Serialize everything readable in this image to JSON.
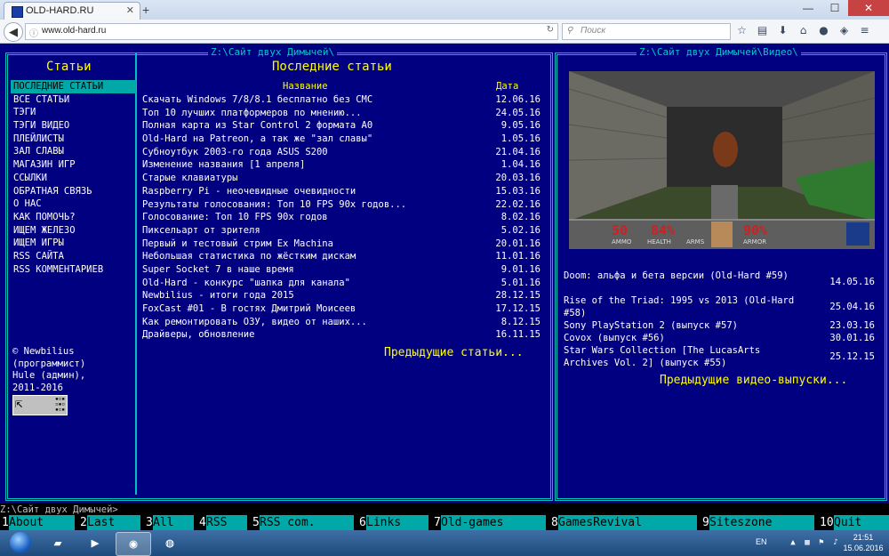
{
  "browser": {
    "tab_title": "OLD-HARD.RU",
    "tab_close": "✕",
    "new_tab": "+",
    "url": "www.old-hard.ru",
    "search_placeholder": "Поиск",
    "window_controls": [
      "—",
      "☐",
      "✕"
    ],
    "nav_icons": [
      "star-icon",
      "bookmarks-icon",
      "download-icon",
      "home-icon",
      "chat-icon",
      "pocket-icon",
      "menu-icon"
    ]
  },
  "left_panel": {
    "title": "Z:\\Сайт двух Димычей\\",
    "sidebar_heading": "Статьи",
    "nav": [
      "ПОСЛЕДНИЕ СТАТЬИ",
      "ВСЕ СТАТЬИ",
      "ТЭГИ",
      "ТЭГИ ВИДЕО",
      "ПЛЕЙЛИСТЫ",
      "ЗАЛ СЛАВЫ",
      "МАГАЗИН ИГР",
      "ССЫЛКИ",
      "ОБРАТНАЯ СВЯЗЬ",
      "О НАС",
      "КАК ПОМОЧЬ?",
      "ИЩЕМ ЖЕЛЕЗО",
      "ИЩЕМ ИГРЫ",
      "RSS САЙТА",
      "RSS КОММЕНТАРИЕВ"
    ],
    "credits": "© Newbilius\n(программист)\nHule (админ),\n2011-2016",
    "main_heading": "Последние статьи",
    "col_name": "Название",
    "col_date": "Дата",
    "articles": [
      {
        "title": "Скачать Windows 7/8/8.1 бесплатно без СМС",
        "date": "12.06.16"
      },
      {
        "title": "Топ 10 лучших платформеров по мнению...",
        "date": "24.05.16"
      },
      {
        "title": "Полная карта из Star Control 2 формата A0",
        "date": "9.05.16"
      },
      {
        "title": "Old-Hard на Patreon, а так же \"зал славы\"",
        "date": "1.05.16"
      },
      {
        "title": "Субноутбук 2003-го года ASUS S200",
        "date": "21.04.16"
      },
      {
        "title": "Изменение названия [1 апреля]",
        "date": "1.04.16"
      },
      {
        "title": "Старые клавиатуры",
        "date": "20.03.16"
      },
      {
        "title": "Raspberry Pi - неочевидные очевидности",
        "date": "15.03.16"
      },
      {
        "title": "Результаты голосования: Топ 10 FPS 90х годов...",
        "date": "22.02.16"
      },
      {
        "title": "Голосование: Топ 10 FPS 90х годов",
        "date": "8.02.16"
      },
      {
        "title": "Пиксельарт от зрителя",
        "date": "5.02.16"
      },
      {
        "title": "Первый и тестовый стрим Ex Machina",
        "date": "20.01.16"
      },
      {
        "title": "Небольшая статистика по жёстким дискам",
        "date": "11.01.16"
      },
      {
        "title": "Super Socket 7 в наше время",
        "date": "9.01.16"
      },
      {
        "title": "Old-Hard - конкурс \"шапка для канала\"",
        "date": "5.01.16"
      },
      {
        "title": "Newbilius - итоги года 2015",
        "date": "28.12.15"
      },
      {
        "title": "FoxCast #01 - В гостях Дмитрий Моисеев",
        "date": "17.12.15"
      },
      {
        "title": "Как ремонтировать ОЗУ, видео от наших...",
        "date": "8.12.15"
      },
      {
        "title": "Драйверы, обновление",
        "date": "16.11.15"
      }
    ],
    "prev_articles": "Предыдущие статьи..."
  },
  "right_panel": {
    "title": "Z:\\Сайт двух Димычей\\Видео\\",
    "hud": {
      "ammo": "50",
      "health": "84%",
      "armor": "90%",
      "ammo_label": "AMMO",
      "health_label": "HEALTH",
      "arms_label": "ARMS",
      "armor_label": "ARMOR"
    },
    "videos": [
      {
        "title": "Doom: альфа и бета версии (Old-Hard #59)",
        "date": "14.05.16"
      },
      {
        "title": "Rise of the Triad: 1995 vs 2013 (Old-Hard #58)",
        "date": "25.04.16"
      },
      {
        "title": "Sony PlayStation 2 (выпуск #57)",
        "date": "23.03.16"
      },
      {
        "title": "Covox (выпуск #56)",
        "date": "30.01.16"
      },
      {
        "title": "Star Wars Collection [The LucasArts Archives Vol. 2] (выпуск #55)",
        "date": "25.12.15"
      }
    ],
    "prev_videos": "Предыдущие видео-выпуски..."
  },
  "command_prompt": "Z:\\Сайт двух Димычей>",
  "fkeys": [
    {
      "n": "1",
      "label": "About"
    },
    {
      "n": "2",
      "label": "Last"
    },
    {
      "n": "3",
      "label": "All"
    },
    {
      "n": "4",
      "label": "RSS"
    },
    {
      "n": "5",
      "label": "RSS com."
    },
    {
      "n": "6",
      "label": "Links"
    },
    {
      "n": "7",
      "label": "Old-games"
    },
    {
      "n": "8",
      "label": "GamesRevival"
    },
    {
      "n": "9",
      "label": "Siteszone"
    },
    {
      "n": "10",
      "label": "Quit"
    }
  ],
  "taskbar": {
    "lang": "EN",
    "time": "21:51",
    "date": "15.06.2016"
  }
}
